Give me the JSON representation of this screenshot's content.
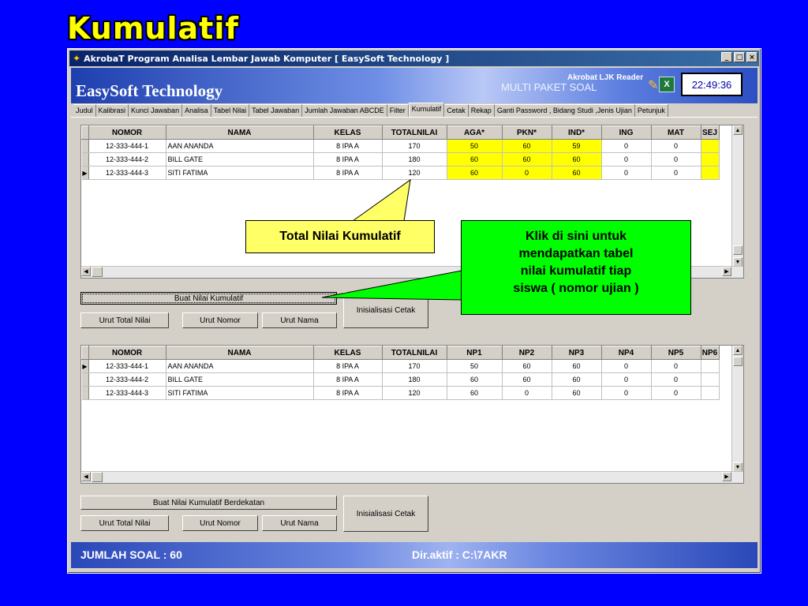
{
  "slide_title": "Kumulatif",
  "window": {
    "title": "AkrobaT   Program Analisa Lembar Jawab Komputer  [ EasySoft Technology ]",
    "controls": [
      "_",
      "□",
      "×"
    ]
  },
  "header": {
    "brand": "EasySoft Technology",
    "multi_label": "MULTI PAKET SOAL",
    "reader_label": "Akrobat LJK Reader",
    "clock": "22:49:36",
    "excel_glyph": "X"
  },
  "tabs": [
    "Judul",
    "Kalibrasi",
    "Kunci Jawaban",
    "Analisa",
    "Tabel Nilai",
    "Tabel Jawaban",
    "Jumlah Jawaban ABCDE",
    "Filter",
    "Kumulatif",
    "Cetak",
    "Rekap",
    "Ganti Password , Bidang Studi ,Jenis Ujian",
    "Petunjuk"
  ],
  "active_tab": "Kumulatif",
  "grid1": {
    "columns": [
      "NOMOR",
      "NAMA",
      "KELAS",
      "TOTALNILAI",
      "AGA*",
      "PKN*",
      "IND*",
      "ING",
      "MAT",
      "SEJ"
    ],
    "rows": [
      [
        "12-333-444-1",
        "AAN ANANDA",
        "8 IPA A",
        "170",
        "50",
        "60",
        "59",
        "0",
        "0",
        ""
      ],
      [
        "12-333-444-2",
        "BILL GATE",
        "8 IPA A",
        "180",
        "60",
        "60",
        "60",
        "0",
        "0",
        ""
      ],
      [
        "12-333-444-3",
        "SITI FATIMA",
        "8 IPA A",
        "120",
        "60",
        "0",
        "60",
        "0",
        "0",
        ""
      ]
    ],
    "current_row_marker": "▶"
  },
  "buttons1": {
    "buat": "Buat Nilai Kumulatif",
    "urut_total": "Urut Total Nilai",
    "urut_nomor": "Urut Nomor",
    "urut_nama": "Urut Nama",
    "inisialisasi": "Inisialisasi Cetak"
  },
  "grid2": {
    "columns": [
      "NOMOR",
      "NAMA",
      "KELAS",
      "TOTALNILAI",
      "NP1",
      "NP2",
      "NP3",
      "NP4",
      "NP5",
      "NP6"
    ],
    "rows": [
      [
        "12-333-444-1",
        "AAN ANANDA",
        "8 IPA A",
        "170",
        "50",
        "60",
        "60",
        "0",
        "0",
        ""
      ],
      [
        "12-333-444-2",
        "BILL GATE",
        "8 IPA A",
        "180",
        "60",
        "60",
        "60",
        "0",
        "0",
        ""
      ],
      [
        "12-333-444-3",
        "SITI FATIMA",
        "8 IPA A",
        "120",
        "60",
        "0",
        "60",
        "0",
        "0",
        ""
      ]
    ],
    "current_row_marker": "▶"
  },
  "buttons2": {
    "buat": "Buat Nilai Kumulatif Berdekatan",
    "urut_total": "Urut Total Nilai",
    "urut_nomor": "Urut Nomor",
    "urut_nama": "Urut Nama",
    "inisialisasi": "Inisialisasi Cetak"
  },
  "status": {
    "jumlah_soal": "JUMLAH SOAL : 60",
    "dir_aktif": "Dir.aktif : C:\\7AKR"
  },
  "callouts": {
    "total_nilai": "Total Nilai Kumulatif",
    "klik_line1": "Klik di sini untuk",
    "klik_line2": "mendapatkan tabel",
    "klik_line3": "nilai kumulatif tiap",
    "klik_line4": "siswa ( nomor ujian )"
  },
  "colors": {
    "slide_bg": "#0000ff",
    "title": "#ffff00",
    "highlight_cells": "#ffff00",
    "callout_yellow": "#ffff66",
    "callout_green": "#00ff00"
  },
  "icons": [
    "app-icon",
    "pencil-icon",
    "excel-icon",
    "scroll-arrow-icon"
  ]
}
